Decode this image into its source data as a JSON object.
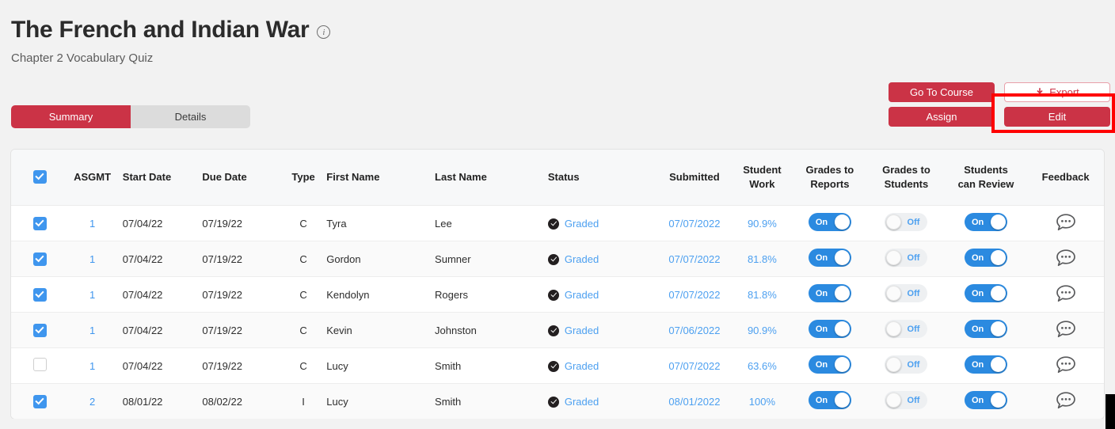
{
  "header": {
    "title": "The French and Indian War",
    "info_icon": "info-circle-icon",
    "subtitle": "Chapter 2 Vocabulary Quiz"
  },
  "actions": {
    "go_to_course": "Go To Course",
    "assign": "Assign",
    "export": "Export",
    "export_icon": "download-icon",
    "edit": "Edit",
    "highlight_color": "#ff0000",
    "primary_color": "#cb3346"
  },
  "tabs": [
    {
      "label": "Summary",
      "active": true
    },
    {
      "label": "Details",
      "active": false
    }
  ],
  "table": {
    "headers": {
      "select_all": "select-all-checkbox",
      "asgmt": "ASGMT",
      "start_date": "Start Date",
      "due_date": "Due Date",
      "type": "Type",
      "first_name": "First Name",
      "last_name": "Last Name",
      "status": "Status",
      "submitted": "Submitted",
      "student_work": "Student\nWork",
      "student_work_l1": "Student",
      "student_work_l2": "Work",
      "grades_to_reports_l1": "Grades to",
      "grades_to_reports_l2": "Reports",
      "grades_to_students_l1": "Grades to",
      "grades_to_students_l2": "Students",
      "students_can_review_l1": "Students",
      "students_can_review_l2": "can Review",
      "feedback": "Feedback"
    },
    "select_all_checked": true,
    "rows": [
      {
        "selected": true,
        "asgmt": "1",
        "start_date": "07/04/22",
        "due_date": "07/19/22",
        "type": "C",
        "first_name": "Tyra",
        "last_name": "Lee",
        "status": "Graded",
        "submitted": "07/07/2022",
        "student_work": "90.9%",
        "grades_to_reports": "On",
        "grades_to_students": "Off",
        "students_can_review": "On",
        "feedback_icon": "comment-bubble-icon"
      },
      {
        "selected": true,
        "asgmt": "1",
        "start_date": "07/04/22",
        "due_date": "07/19/22",
        "type": "C",
        "first_name": "Gordon",
        "last_name": "Sumner",
        "status": "Graded",
        "submitted": "07/07/2022",
        "student_work": "81.8%",
        "grades_to_reports": "On",
        "grades_to_students": "Off",
        "students_can_review": "On",
        "feedback_icon": "comment-bubble-icon"
      },
      {
        "selected": true,
        "asgmt": "1",
        "start_date": "07/04/22",
        "due_date": "07/19/22",
        "type": "C",
        "first_name": "Kendolyn",
        "last_name": "Rogers",
        "status": "Graded",
        "submitted": "07/07/2022",
        "student_work": "81.8%",
        "grades_to_reports": "On",
        "grades_to_students": "Off",
        "students_can_review": "On",
        "feedback_icon": "comment-bubble-icon"
      },
      {
        "selected": true,
        "asgmt": "1",
        "start_date": "07/04/22",
        "due_date": "07/19/22",
        "type": "C",
        "first_name": "Kevin",
        "last_name": "Johnston",
        "status": "Graded",
        "submitted": "07/06/2022",
        "student_work": "90.9%",
        "grades_to_reports": "On",
        "grades_to_students": "Off",
        "students_can_review": "On",
        "feedback_icon": "comment-bubble-icon"
      },
      {
        "selected": false,
        "asgmt": "1",
        "start_date": "07/04/22",
        "due_date": "07/19/22",
        "type": "C",
        "first_name": "Lucy",
        "last_name": "Smith",
        "status": "Graded",
        "submitted": "07/07/2022",
        "student_work": "63.6%",
        "grades_to_reports": "On",
        "grades_to_students": "Off",
        "students_can_review": "On",
        "feedback_icon": "comment-bubble-icon"
      },
      {
        "selected": true,
        "asgmt": "2",
        "start_date": "08/01/22",
        "due_date": "08/02/22",
        "type": "I",
        "first_name": "Lucy",
        "last_name": "Smith",
        "status": "Graded",
        "submitted": "08/01/2022",
        "student_work": "100%",
        "grades_to_reports": "On",
        "grades_to_students": "Off",
        "students_can_review": "On",
        "feedback_icon": "comment-bubble-icon"
      }
    ]
  }
}
